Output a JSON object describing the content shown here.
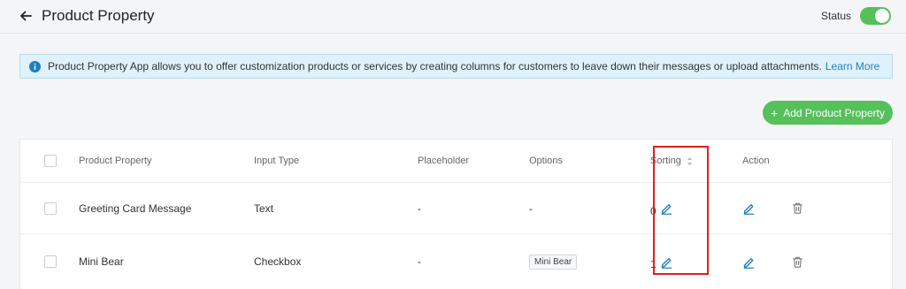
{
  "header": {
    "title": "Product Property",
    "status_label": "Status",
    "status_on": true,
    "back_icon": "arrow-left-icon",
    "accent_color": "#56c05a"
  },
  "banner": {
    "text": "Product Property App allows you to offer customization products or services by creating columns for customers to leave down their messages or upload attachments.",
    "link_text": "Learn More",
    "icon": "info-icon",
    "link_color": "#1f7fc4"
  },
  "toolbar": {
    "add_button_label": "Add Product Property"
  },
  "table": {
    "columns": {
      "property": "Product Property",
      "input_type": "Input Type",
      "placeholder": "Placeholder",
      "options": "Options",
      "sorting": "Sorting",
      "action": "Action"
    },
    "rows": [
      {
        "property": "Greeting Card Message",
        "input_type": "Text",
        "placeholder": "-",
        "options": "-",
        "sorting": "0"
      },
      {
        "property": "Mini Bear",
        "input_type": "Checkbox",
        "placeholder": "-",
        "options": "Mini Bear",
        "sorting": "1"
      }
    ]
  },
  "annotation": {
    "highlight_color": "#e02020"
  }
}
